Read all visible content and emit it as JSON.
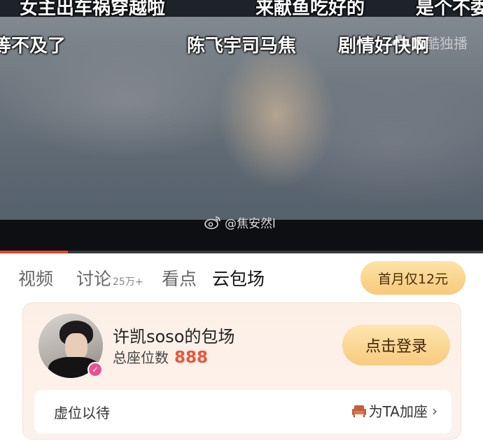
{
  "video": {
    "danmu": [
      "女主出车祸穿越啦",
      "来献鱼吃好的",
      "是个不委",
      "等不及了",
      "陈飞宇司马焦",
      "剧情好快啊"
    ],
    "channel_logo": "优酷独播",
    "watermark": "@焦安然l",
    "progress": 0.14
  },
  "tabs": [
    {
      "label": "视频",
      "badge": ""
    },
    {
      "label": "讨论",
      "badge": "25万+"
    },
    {
      "label": "看点",
      "badge": ""
    },
    {
      "label": "云包场",
      "badge": ""
    }
  ],
  "promo_button": "首月仅12元",
  "card": {
    "title": "许凯soso的包场",
    "seats_label": "总座位数",
    "seat_count": "888",
    "login_button": "点击登录",
    "vacant_text": "虚位以待",
    "add_seat_link": "为TA加座"
  },
  "colors": {
    "accent": "#e8573a",
    "button_gold": "#f8ca7d",
    "progress": "#f0402e",
    "verified": "#ef4f8f"
  },
  "icons": [
    "weibo-icon",
    "verified-icon",
    "sofa-icon",
    "chevron-right-icon",
    "youku-logo-icon"
  ]
}
